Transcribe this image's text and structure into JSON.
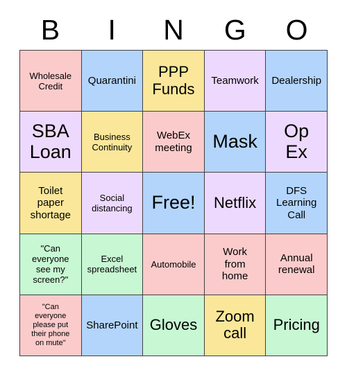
{
  "header": {
    "letters": [
      "B",
      "I",
      "N",
      "G",
      "O"
    ]
  },
  "palette": {
    "pink": "#FBCBCB",
    "blue": "#B3D5FB",
    "yellow": "#FAE79A",
    "lavender": "#EDD9FD",
    "green": "#C8F7D4",
    "border": "#404040",
    "text": "#000000",
    "background": "#FFFFFF"
  },
  "grid": {
    "rows": 5,
    "columns": 5,
    "cells": [
      {
        "text": "Wholesale\nCredit",
        "color": "#FBCBCB",
        "size": "s"
      },
      {
        "text": "Quarantini",
        "color": "#B3D5FB",
        "size": "m"
      },
      {
        "text": "PPP\nFunds",
        "color": "#FAE79A",
        "size": "l"
      },
      {
        "text": "Teamwork",
        "color": "#EDD9FD",
        "size": "m"
      },
      {
        "text": "Dealership",
        "color": "#B3D5FB",
        "size": "m"
      },
      {
        "text": "SBA\nLoan",
        "color": "#EDD9FD",
        "size": "xl"
      },
      {
        "text": "Business\nContinuity",
        "color": "#FAE79A",
        "size": "s"
      },
      {
        "text": "WebEx\nmeeting",
        "color": "#FBCBCB",
        "size": "m"
      },
      {
        "text": "Mask",
        "color": "#B3D5FB",
        "size": "xl"
      },
      {
        "text": "Op\nEx",
        "color": "#EDD9FD",
        "size": "xl"
      },
      {
        "text": "Toilet\npaper\nshortage",
        "color": "#FAE79A",
        "size": "m"
      },
      {
        "text": "Social\ndistancing",
        "color": "#EDD9FD",
        "size": "s"
      },
      {
        "text": "Free!",
        "color": "#B3D5FB",
        "size": "xl"
      },
      {
        "text": "Netflix",
        "color": "#EDD9FD",
        "size": "l"
      },
      {
        "text": "DFS\nLearning\nCall",
        "color": "#B3D5FB",
        "size": "m"
      },
      {
        "text": "\"Can\neveryone\nsee my\nscreen?\"",
        "color": "#C8F7D4",
        "size": "s"
      },
      {
        "text": "Excel\nspreadsheet",
        "color": "#C8F7D4",
        "size": "s"
      },
      {
        "text": "Automobile",
        "color": "#FBCBCB",
        "size": "s"
      },
      {
        "text": "Work\nfrom\nhome",
        "color": "#FBCBCB",
        "size": "m"
      },
      {
        "text": "Annual\nrenewal",
        "color": "#FBCBCB",
        "size": "m"
      },
      {
        "text": "\"Can\neveryone\nplease put\ntheir phone\non mute\"",
        "color": "#FBCBCB",
        "size": "xs"
      },
      {
        "text": "SharePoint",
        "color": "#B3D5FB",
        "size": "m"
      },
      {
        "text": "Gloves",
        "color": "#C8F7D4",
        "size": "l"
      },
      {
        "text": "Zoom\ncall",
        "color": "#FAE79A",
        "size": "l"
      },
      {
        "text": "Pricing",
        "color": "#C8F7D4",
        "size": "l"
      }
    ]
  }
}
